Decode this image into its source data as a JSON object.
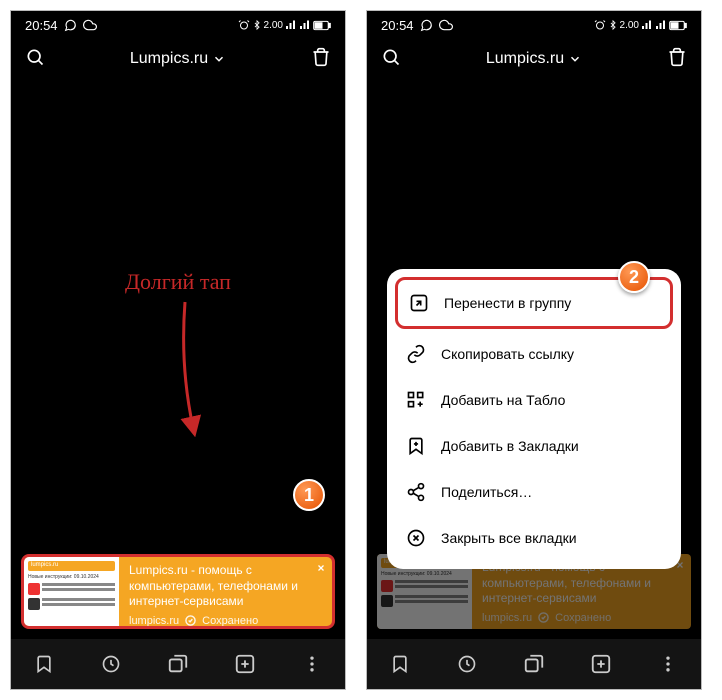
{
  "statusbar": {
    "time": "20:54",
    "net_label": "2.00"
  },
  "topbar": {
    "title": "Lumpics.ru"
  },
  "annotations": {
    "long_tap": "Долгий тап",
    "badge1": "1",
    "badge2": "2"
  },
  "tab_card": {
    "thumb_header": "lumpics.ru",
    "thumb_date": "Новые инструкции: 09.10.2024",
    "title": "Lumpics.ru - помощь с компьютерами, телефонами и интернет-сервисами",
    "domain": "lumpics.ru",
    "status": "Сохранено"
  },
  "context_menu": {
    "items": [
      {
        "label": "Перенести в группу"
      },
      {
        "label": "Скопировать ссылку"
      },
      {
        "label": "Добавить на Табло"
      },
      {
        "label": "Добавить в Закладки"
      },
      {
        "label": "Поделиться…"
      },
      {
        "label": "Закрыть все вкладки"
      }
    ]
  }
}
